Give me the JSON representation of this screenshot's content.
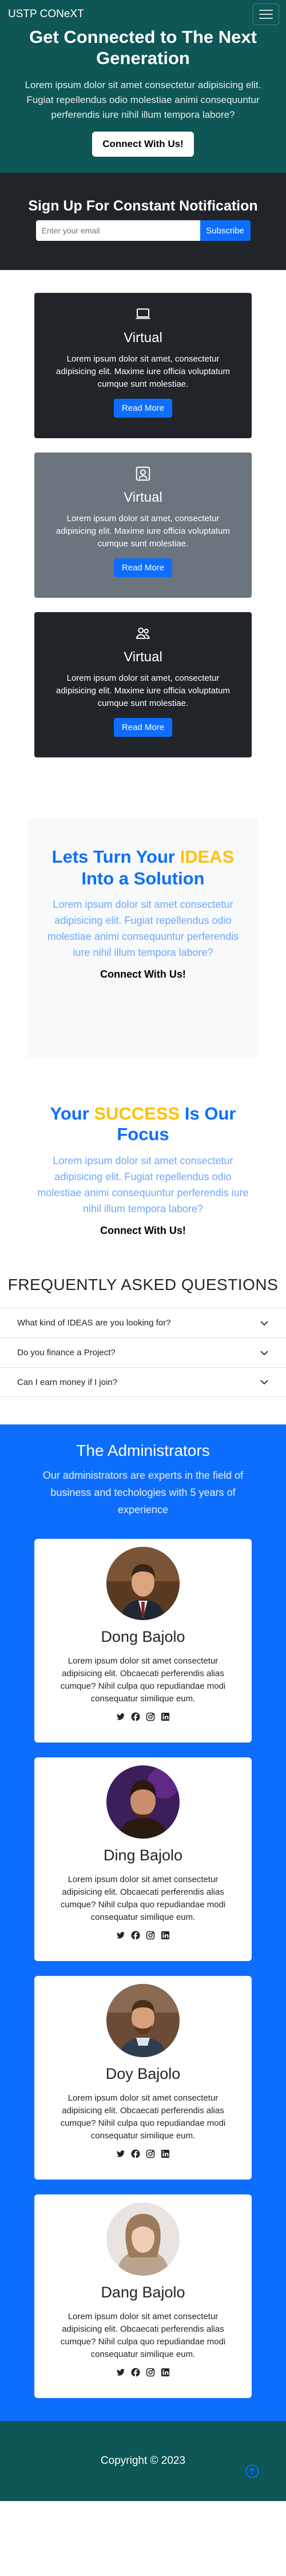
{
  "nav": {
    "brand": "USTP CONeXT",
    "menu_icon": "hamburger-menu-icon"
  },
  "hero": {
    "title": "Get Connected to The Next Generation",
    "text": "Lorem ipsum dolor sit amet consectetur adipisicing elit. Fugiat repellendus odio molestiae animi consequuntur perferendis iure nihil illum tempora labore?",
    "button": "Connect With Us!"
  },
  "subscribe": {
    "title": "Sign Up For Constant Notification",
    "placeholder": "Enter your email",
    "button": "Subscribe"
  },
  "features": [
    {
      "icon": "laptop-icon",
      "title": "Virtual",
      "text": "Lorem ipsum dolor sit amet, consectetur adipisicing elit. Maxime iure officia voluptatum cumque sunt molestiae.",
      "button": "Read More"
    },
    {
      "icon": "person-badge-icon",
      "title": "Virtual",
      "text": "Lorem ipsum dolor sit amet, consectetur adipisicing elit. Maxime iure officia voluptatum cumque sunt molestiae.",
      "button": "Read More"
    },
    {
      "icon": "people-icon",
      "title": "Virtual",
      "text": "Lorem ipsum dolor sit amet, consectetur adipisicing elit. Maxime iure officia voluptatum cumque sunt molestiae.",
      "button": "Read More"
    }
  ],
  "ideas": {
    "title_before": "Lets Turn Your ",
    "title_highlight": "IDEAS",
    "title_after": " Into a Solution",
    "text": "Lorem ipsum dolor sit amet consectetur adipisicing elit. Fugiat repellendus odio molestiae animi consequuntur perferendis iure nihil illum tempora labore?",
    "button": "Connect With Us!"
  },
  "success": {
    "title_before": "Your ",
    "title_highlight": "SUCCESS",
    "title_after": " Is Our Focus",
    "text": "Lorem ipsum dolor sit amet consectetur adipisicing elit. Fugiat repellendus odio molestiae animi consequuntur perferendis iure nihil illum tempora labore?",
    "button": "Connect With Us!"
  },
  "faq": {
    "title": "FREQUENTLY ASKED QUESTIONS",
    "items": [
      "What kind of IDEAS are you looking for?",
      "Do you finance a Project?",
      "Can I earn money if I join?"
    ]
  },
  "admins": {
    "title": "The Administrators",
    "text": "Our administrators are experts in the field of business and techologies with 5 years of experience",
    "members": [
      {
        "name": "Dong Bajolo",
        "text": "Lorem ipsum dolor sit amet consectetur adipisicing elit. Obcaecati perferendis alias cumque? Nihil culpa quo repudiandae modi consequatur similique eum."
      },
      {
        "name": "Ding Bajolo",
        "text": "Lorem ipsum dolor sit amet consectetur adipisicing elit. Obcaecati perferendis alias cumque? Nihil culpa quo repudiandae modi consequatur similique eum."
      },
      {
        "name": "Doy Bajolo",
        "text": "Lorem ipsum dolor sit amet consectetur adipisicing elit. Obcaecati perferendis alias cumque? Nihil culpa quo repudiandae modi consequatur similique eum."
      },
      {
        "name": "Dang Bajolo",
        "text": "Lorem ipsum dolor sit amet consectetur adipisicing elit. Obcaecati perferendis alias cumque? Nihil culpa quo repudiandae modi consequatur similique eum."
      }
    ],
    "social_icons": [
      "twitter-icon",
      "facebook-icon",
      "instagram-icon",
      "linkedin-icon"
    ]
  },
  "footer": {
    "text": "Copyright © 2023",
    "up_icon": "arrow-up-circle-icon"
  },
  "colors": {
    "teal": "#0f5656",
    "dark": "#212529",
    "grey": "#6c757d",
    "blue": "#0d6efd",
    "light_blue": "#6ea8fe",
    "yellow": "#ffc107"
  }
}
